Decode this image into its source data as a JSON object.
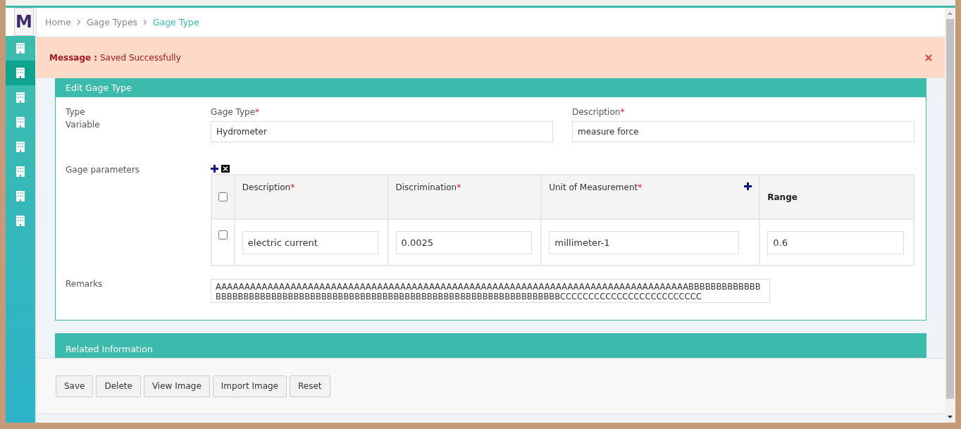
{
  "sidebar": {
    "logo": "M",
    "items": [
      {
        "selected": false
      },
      {
        "selected": true
      },
      {
        "selected": false
      },
      {
        "selected": false
      },
      {
        "selected": false
      },
      {
        "selected": false
      },
      {
        "selected": false
      },
      {
        "selected": false
      }
    ]
  },
  "breadcrumb": [
    {
      "label": "Home",
      "current": false
    },
    {
      "label": "Gage Types",
      "current": false
    },
    {
      "label": "Gage Type",
      "current": true
    }
  ],
  "message": {
    "label": "Message :",
    "text": "Saved Successfully"
  },
  "edit_panel": {
    "title": "Edit Gage Type",
    "type_label": "Type",
    "type_value": "Variable",
    "fields": [
      {
        "label": "Gage Type",
        "required_mark": "*",
        "value": "Hydrometer"
      },
      {
        "label": "Description",
        "required_mark": "*",
        "value": "measure force"
      }
    ],
    "parameters": {
      "label": "Gage parameters",
      "select_all_checked": false,
      "columns": [
        {
          "label": "Description",
          "required_mark": "*",
          "has_add": false
        },
        {
          "label": "Discrimination",
          "required_mark": "*",
          "has_add": false
        },
        {
          "label": "Unit of Measurement",
          "required_mark": "*",
          "has_add": true
        },
        {
          "label": "Range",
          "has_add": false
        }
      ],
      "rows": [
        {
          "checked": false,
          "cells": [
            "electric current",
            "0.0025",
            "millimeter-1",
            "0.6"
          ]
        }
      ]
    },
    "remarks": {
      "label": "Remarks",
      "value": "AAAAAAAAAAAAAAAAAAAAAAAAAAAAAAAAAAAAAAAAAAAAAAAAAAAAAAAAAAAAAAAAAAAAAAAAAAAAAAAAAABBBBBBBBBBBBBBBBBBBBBBBBBBBBBBBBBBBBBBBBBBBBBBBBBBBBBBBBBBBBBBBBBBBBBBBBBBBCCCCCCCCCCCCCCCCCCCCCCCCC"
    }
  },
  "related_panel": {
    "title": "Related Information"
  },
  "buttons": [
    "Save",
    "Delete",
    "View Image",
    "Import Image",
    "Reset"
  ]
}
